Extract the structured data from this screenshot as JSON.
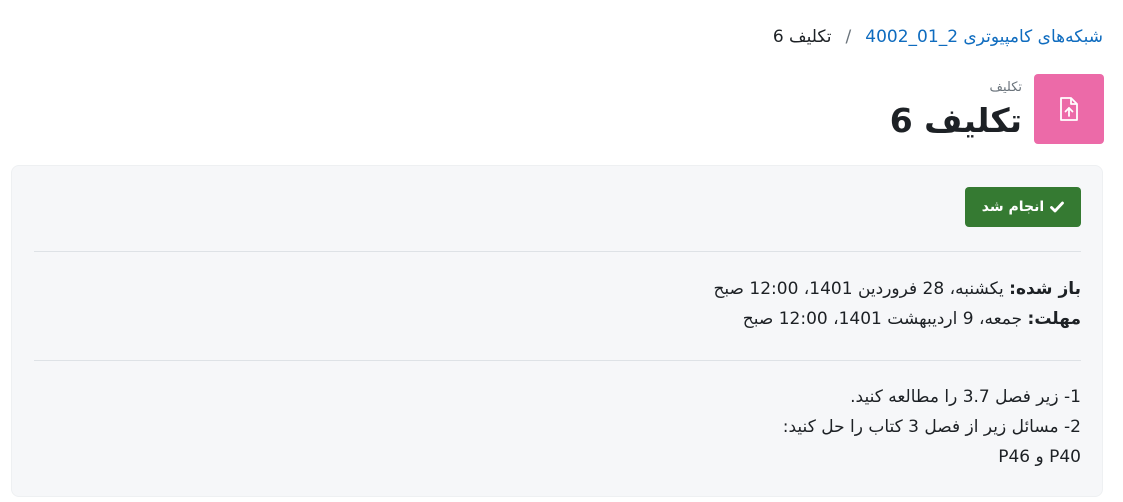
{
  "breadcrumb": {
    "course": "شبکه‌های کامپیوتری 2_01_4002",
    "separator": "/",
    "current": "تکلیف 6"
  },
  "header": {
    "activity_type": "تکلیف",
    "title": "تکلیف 6",
    "icon": "assignment-upload-icon",
    "icon_bg": "#ec6aa8"
  },
  "completion": {
    "label": "انجام شد",
    "icon": "check-icon",
    "color": "#357a32"
  },
  "dates": {
    "opened_label": "باز شده:",
    "opened_value": "یکشنبه، 28 فروردین 1401، 12:00 صبح",
    "due_label": "مهلت:",
    "due_value": "جمعه، 9 اردیبهشت 1401، 12:00 صبح"
  },
  "intro": {
    "lines": [
      "1- زیر فصل 3.7 را مطالعه کنید.",
      "2- مسائل زیر از فصل 3 کتاب را حل کنید:",
      "P40 و P46"
    ]
  }
}
